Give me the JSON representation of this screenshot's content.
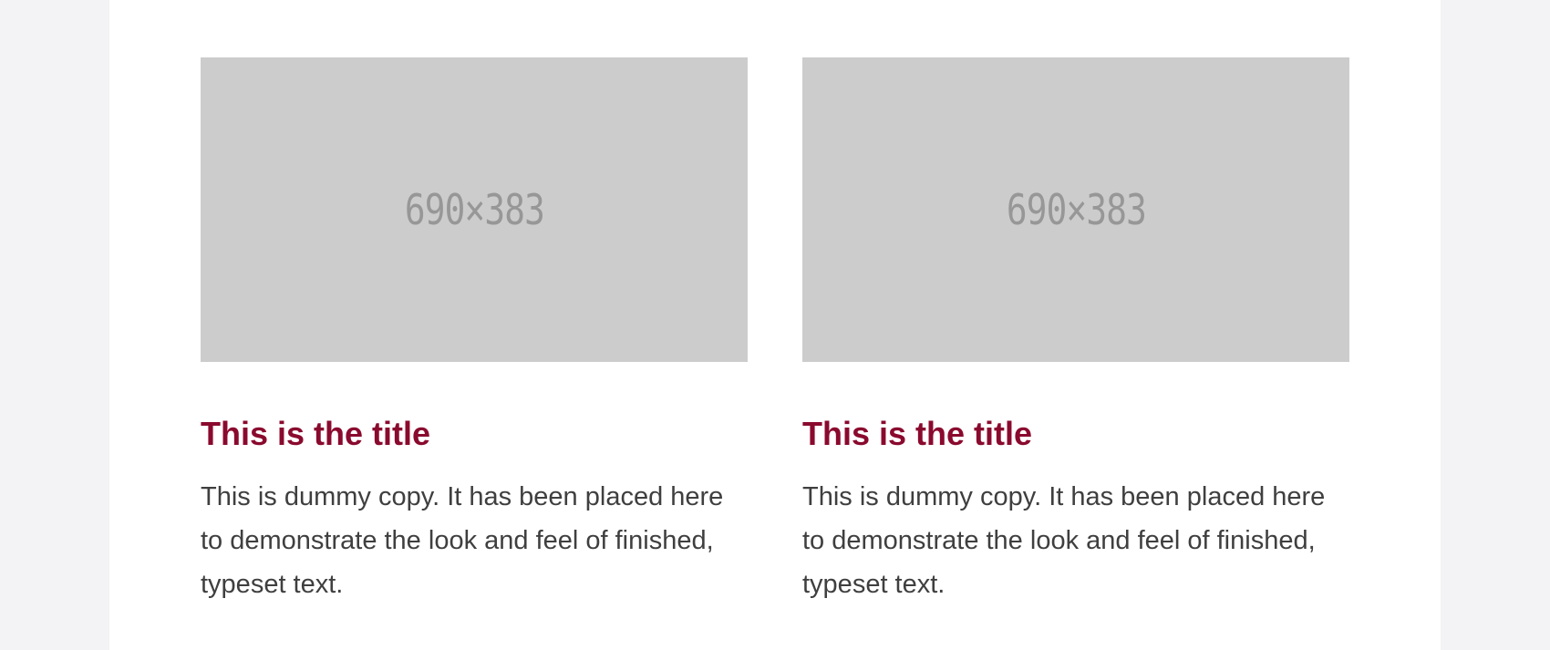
{
  "cards": [
    {
      "image_label": "690×383",
      "title": "This is the title",
      "body": "This is dummy copy. It has been placed here to demonstrate the look and feel of finished, typeset text."
    },
    {
      "image_label": "690×383",
      "title": "This is the title",
      "body": "This is dummy copy. It has been placed here to demonstrate the look and feel of finished, typeset text."
    }
  ],
  "colors": {
    "page_background": "#f3f3f5",
    "content_background": "#ffffff",
    "placeholder_fill": "#cccccc",
    "placeholder_text": "#979797",
    "title": "#8a0a2e",
    "body_text": "#3f3f3f"
  }
}
